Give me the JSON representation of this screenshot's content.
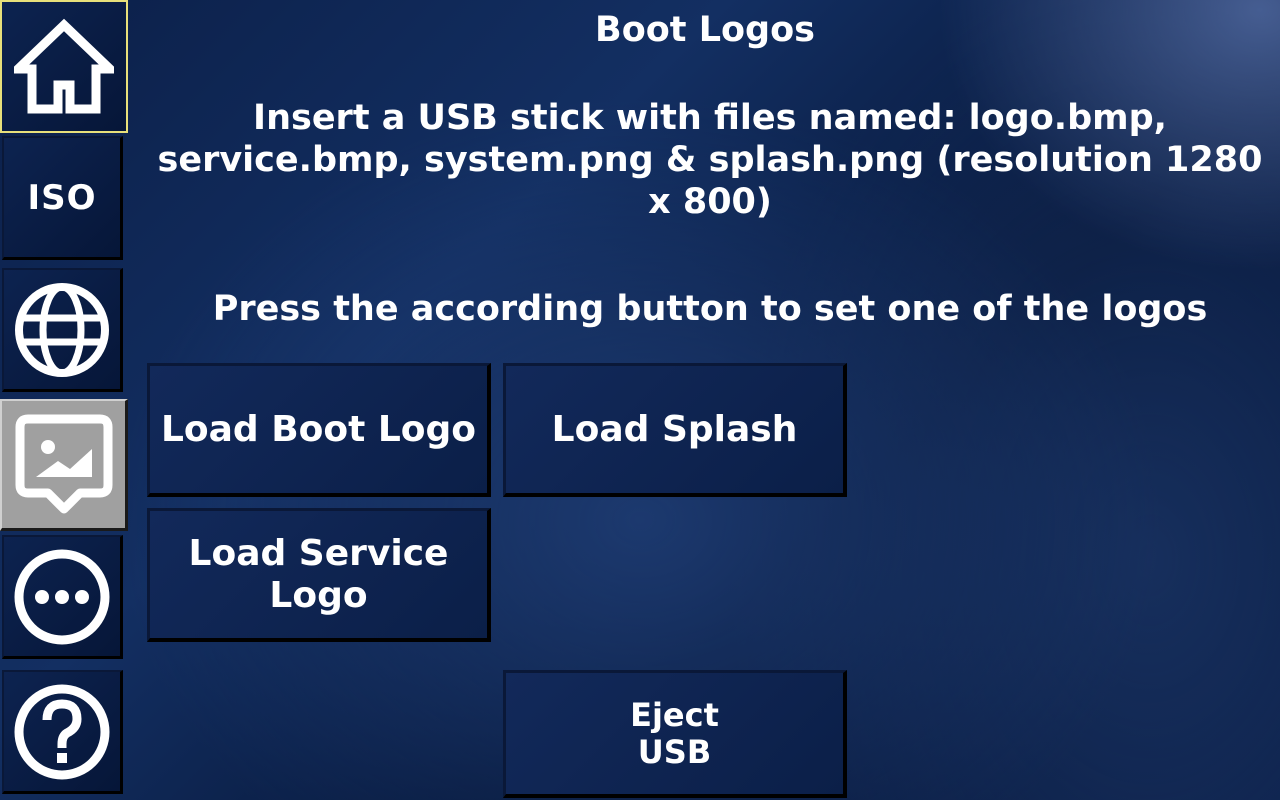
{
  "sidebar": {
    "items": [
      {
        "name": "home",
        "icon": "home-icon"
      },
      {
        "name": "iso",
        "label": "ISO"
      },
      {
        "name": "network",
        "icon": "globe-icon"
      },
      {
        "name": "boot-logos",
        "icon": "image-icon",
        "active": true
      },
      {
        "name": "more",
        "icon": "more-icon"
      },
      {
        "name": "help",
        "icon": "help-icon"
      }
    ]
  },
  "page": {
    "title": "Boot Logos",
    "instructions": "Insert a USB stick with files named:  logo.bmp,\nservice.bmp, system.png & splash.png (resolution 1280\nx 800)",
    "prompt": "Press the according button to set one of the logos"
  },
  "buttons": {
    "load_boot_logo": "Load Boot Logo",
    "load_splash": "Load Splash",
    "load_service_logo": "Load Service\nLogo",
    "eject_usb": "Eject\nUSB"
  },
  "colors": {
    "selected_border": "#e8e07a",
    "active_tab_bg": "#a0a0a0",
    "background": "#0b1f48",
    "text": "#ffffff"
  }
}
